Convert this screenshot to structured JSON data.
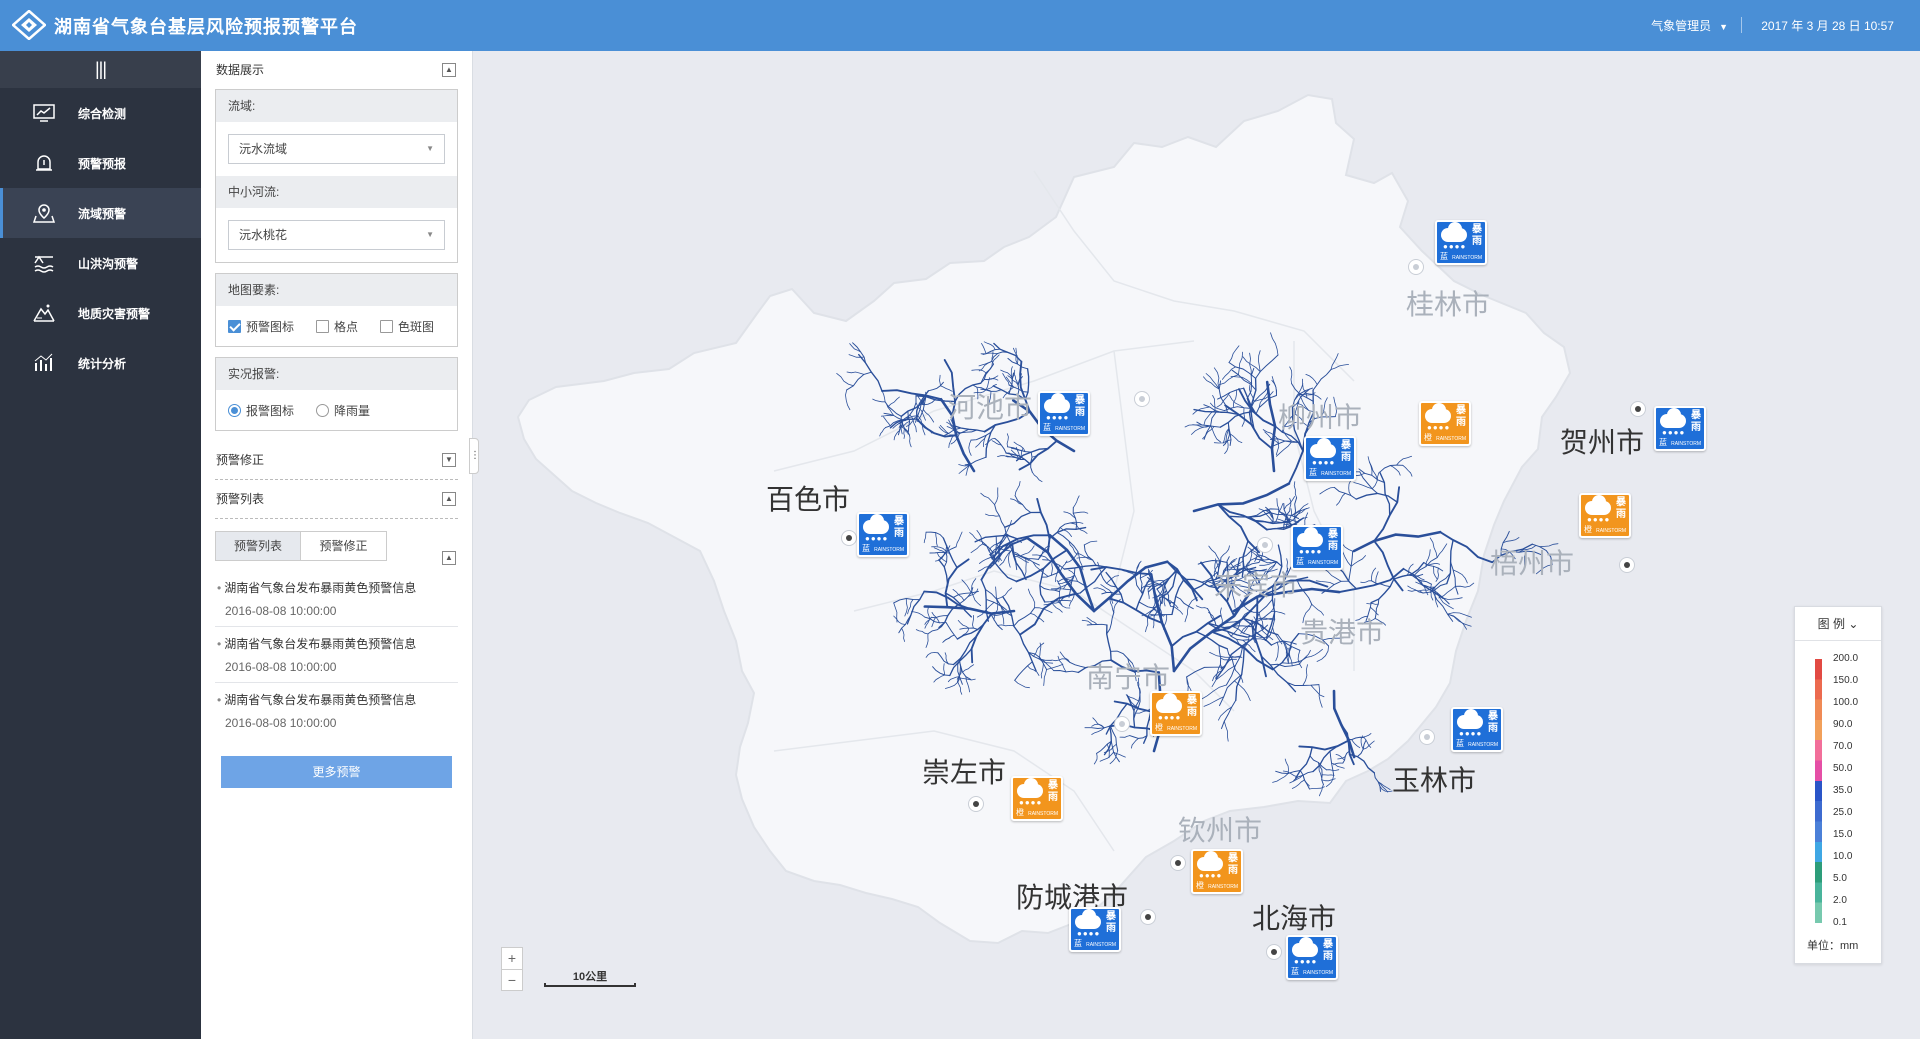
{
  "header": {
    "title": "湖南省气象台基层风险预报预警平台",
    "user": "气象管理员",
    "date": "2017 年 3 月 28 日 10:57",
    "bg_color": "#4a8fd6"
  },
  "sidebar": {
    "toggle_icon": "menu-icon",
    "items": [
      {
        "label": "综合检测",
        "icon": "monitor-icon"
      },
      {
        "label": "预警预报",
        "icon": "alarm-bell-icon"
      },
      {
        "label": "流域预警",
        "icon": "map-pin-icon",
        "active": true
      },
      {
        "label": "山洪沟预警",
        "icon": "flood-icon"
      },
      {
        "label": "地质灾害预警",
        "icon": "landslide-icon"
      },
      {
        "label": "统计分析",
        "icon": "bar-chart-icon"
      }
    ]
  },
  "panel": {
    "data_display": {
      "title": "数据展示",
      "toggle": "▲"
    },
    "basin": {
      "label": "流域:",
      "value": "沅水流域"
    },
    "river": {
      "label": "中小河流:",
      "value": "沅水桃花"
    },
    "map_elements": {
      "label": "地图要素:",
      "options": [
        {
          "label": "预警图标",
          "checked": true
        },
        {
          "label": "格点",
          "checked": false
        },
        {
          "label": "色斑图",
          "checked": false
        }
      ]
    },
    "live_alarm": {
      "label": "实况报警:",
      "options": [
        {
          "label": "报警图标",
          "selected": true
        },
        {
          "label": "降雨量",
          "selected": false
        }
      ]
    },
    "correction": {
      "title": "预警修正",
      "toggle": "▼"
    },
    "warning_list": {
      "title": "预警列表",
      "toggle": "▲"
    },
    "tabs": [
      "预警列表",
      "预警修正"
    ],
    "tabs_toggle": "▲",
    "warnings": [
      {
        "title": "湖南省气象台发布暴雨黄色预警信息",
        "time": "2016-08-08 10:00:00"
      },
      {
        "title": "湖南省气象台发布暴雨黄色预警信息",
        "time": "2016-08-08 10:00:00"
      },
      {
        "title": "湖南省气象台发布暴雨黄色预警信息",
        "time": "2016-08-08 10:00:00"
      }
    ],
    "more_button": "更多预警"
  },
  "map": {
    "region_fill": "#f6f7fa",
    "river_color": "#2a4f9a",
    "cities": [
      {
        "name": "桂林市",
        "tone": "light"
      },
      {
        "name": "河池市",
        "tone": "light"
      },
      {
        "name": "柳州市",
        "tone": "light"
      },
      {
        "name": "贺州市",
        "tone": "dark"
      },
      {
        "name": "百色市",
        "tone": "dark"
      },
      {
        "name": "梧州市",
        "tone": "light"
      },
      {
        "name": "来宾市",
        "tone": "light"
      },
      {
        "name": "贵港市",
        "tone": "light"
      },
      {
        "name": "南宁市",
        "tone": "light"
      },
      {
        "name": "崇左市",
        "tone": "dark"
      },
      {
        "name": "玉林市",
        "tone": "dark"
      },
      {
        "name": "钦州市",
        "tone": "light"
      },
      {
        "name": "防城港市",
        "tone": "dark"
      },
      {
        "name": "北海市",
        "tone": "dark"
      }
    ],
    "markers": [
      {
        "level": "蓝",
        "type": "暴雨",
        "en": "RAINSTORM",
        "color": "blue"
      },
      {
        "level": "蓝",
        "type": "暴雨",
        "en": "RAINSTORM",
        "color": "blue"
      },
      {
        "level": "橙",
        "type": "暴雨",
        "en": "RAINSTORM",
        "color": "orange"
      },
      {
        "level": "蓝",
        "type": "暴雨",
        "en": "RAINSTORM",
        "color": "blue"
      },
      {
        "level": "蓝",
        "type": "暴雨",
        "en": "RAINSTORM",
        "color": "blue"
      },
      {
        "level": "蓝",
        "type": "暴雨",
        "en": "RAINSTORM",
        "color": "blue"
      },
      {
        "level": "橙",
        "type": "暴雨",
        "en": "RAINSTORM",
        "color": "orange"
      },
      {
        "level": "蓝",
        "type": "暴雨",
        "en": "RAINSTORM",
        "color": "blue"
      },
      {
        "level": "橙",
        "type": "暴雨",
        "en": "RAINSTORM",
        "color": "orange"
      },
      {
        "level": "蓝",
        "type": "暴雨",
        "en": "RAINSTORM",
        "color": "blue"
      },
      {
        "level": "橙",
        "type": "暴雨",
        "en": "RAINSTORM",
        "color": "orange"
      },
      {
        "level": "橙",
        "type": "暴雨",
        "en": "RAINSTORM",
        "color": "orange"
      },
      {
        "level": "蓝",
        "type": "暴雨",
        "en": "RAINSTORM",
        "color": "blue"
      },
      {
        "level": "蓝",
        "type": "暴雨",
        "en": "RAINSTORM",
        "color": "blue"
      }
    ],
    "zoom_in": "+",
    "zoom_out": "−",
    "scale": "10公里"
  },
  "legend": {
    "title": "图 例",
    "values": [
      "200.0",
      "150.0",
      "100.0",
      "90.0",
      "70.0",
      "50.0",
      "35.0",
      "25.0",
      "15.0",
      "10.0",
      "5.0",
      "2.0",
      "0.1"
    ],
    "colors": [
      "#e24a43",
      "#ec6a4f",
      "#f08a55",
      "#f2a05a",
      "#f26f9a",
      "#e54fa6",
      "#2a55c8",
      "#3d6bd0",
      "#4b80d8",
      "#3fa7e4",
      "#2d9d7a",
      "#49b49b",
      "#77c9ae"
    ],
    "unit": "单位：mm"
  }
}
